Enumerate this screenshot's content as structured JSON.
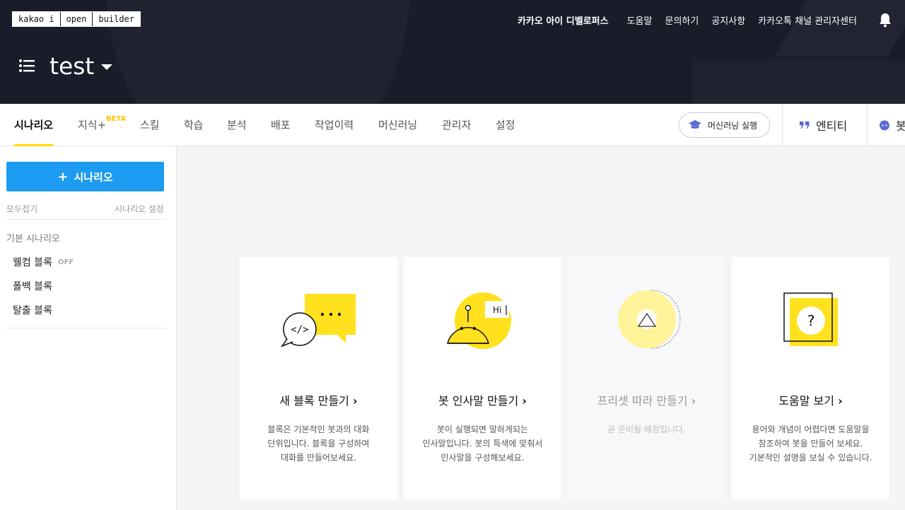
{
  "header": {
    "logo": [
      "kakao i",
      "open",
      "builder"
    ],
    "nav": [
      "카카오 아이 디벨로퍼스",
      "도움말",
      "문의하기",
      "공지사항",
      "카카오톡 채널 관리자센터"
    ],
    "bot_name": "test"
  },
  "tabs": {
    "items": [
      "시나리오",
      "지식+",
      "스킬",
      "학습",
      "분석",
      "배포",
      "작업이력",
      "머신러닝",
      "관리자",
      "설정"
    ],
    "beta_label": "BETA",
    "ml_button": "머신러닝 실행",
    "entity": "엔티티",
    "bot_partial": "봇"
  },
  "sidebar": {
    "add_button": "시나리오",
    "collapse_all": "모두접기",
    "scenario_settings": "시나리오 설정",
    "group_title": "기본 시나리오",
    "items": [
      "웰컴 블록",
      "폴백 블록",
      "탈출 블록"
    ],
    "off_badge": "OFF"
  },
  "cards": [
    {
      "title": "새 블록 만들기",
      "desc": "블록은 기본적인 봇과의 대화\n단위입니다. 블록을 구성하여\n대화를 만들어보세요."
    },
    {
      "title": "봇 인사말 만들기",
      "desc": "봇이 실행되면 말하게되는\n인사말입니다. 봇의 특색에 맞춰서\n인사말을 구성해보세요.",
      "bubble_text": "Hi"
    },
    {
      "title": "프리셋 따라 만들기",
      "desc": "곧 준비될 예정입니다."
    },
    {
      "title": "도움말 보기",
      "desc": "용어와 개념이 어렵다면 도움말을\n참조하여 봇을 만들어 보세요.\n기본적인 설명을 보실 수 있습니다.",
      "icon_text": "?"
    }
  ],
  "colors": {
    "header_bg": "#1a1c2a",
    "accent_yellow": "#ffe11e",
    "primary_blue": "#1d9bf0"
  }
}
